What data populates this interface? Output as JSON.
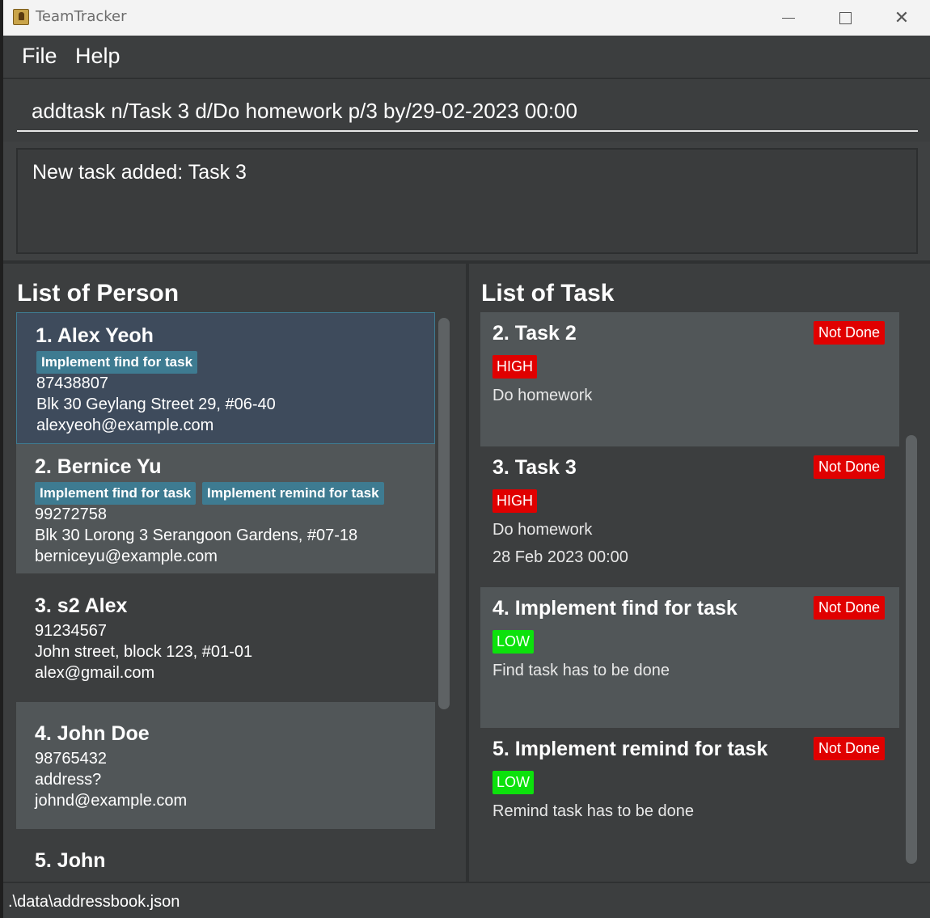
{
  "window": {
    "title": "TeamTracker"
  },
  "menu": {
    "file": "File",
    "help": "Help"
  },
  "command": {
    "value": "addtask n/Task 3 d/Do homework p/3 by/29-02-2023 00:00"
  },
  "result": {
    "text": "New task added: Task 3"
  },
  "person_panel": {
    "title": "List of Person",
    "persons": [
      {
        "name": "1.  Alex Yeoh",
        "tags": [
          "Implement find for task"
        ],
        "phone": "87438807",
        "address": "Blk 30 Geylang Street 29, #06-40",
        "email": "alexyeoh@example.com"
      },
      {
        "name": "2.  Bernice Yu",
        "tags": [
          "Implement find for task",
          "Implement remind for task"
        ],
        "phone": "99272758",
        "address": "Blk 30 Lorong 3 Serangoon Gardens, #07-18",
        "email": "berniceyu@example.com"
      },
      {
        "name": "3.  s2 Alex",
        "tags": [],
        "phone": "91234567",
        "address": "John street, block 123, #01-01",
        "email": "alex@gmail.com"
      },
      {
        "name": "4.  John Doe",
        "tags": [],
        "phone": "98765432",
        "address": "address?",
        "email": "johnd@example.com"
      },
      {
        "name": "5.  John"
      }
    ]
  },
  "task_panel": {
    "title": "List of Task",
    "tasks": [
      {
        "name": "2. Task 2",
        "status": "Not Done",
        "priority": "HIGH",
        "description": "Do homework",
        "deadline": ""
      },
      {
        "name": "3. Task 3",
        "status": "Not Done",
        "priority": "HIGH",
        "description": "Do homework",
        "deadline": "28 Feb 2023 00:00"
      },
      {
        "name": "4. Implement find for task",
        "status": "Not Done",
        "priority": "LOW",
        "description": "Find task has to be done",
        "deadline": ""
      },
      {
        "name": "5. Implement remind for task",
        "status": "Not Done",
        "priority": "LOW",
        "description": "Remind task has to be done",
        "deadline": ""
      }
    ]
  },
  "statusbar": {
    "path": ".\\data\\addressbook.json"
  },
  "colors": {
    "tag": "#3e7b91",
    "high": "#e00000",
    "low": "#0ce10c",
    "not_done": "#e00000",
    "selected": "#3e4b5c"
  }
}
